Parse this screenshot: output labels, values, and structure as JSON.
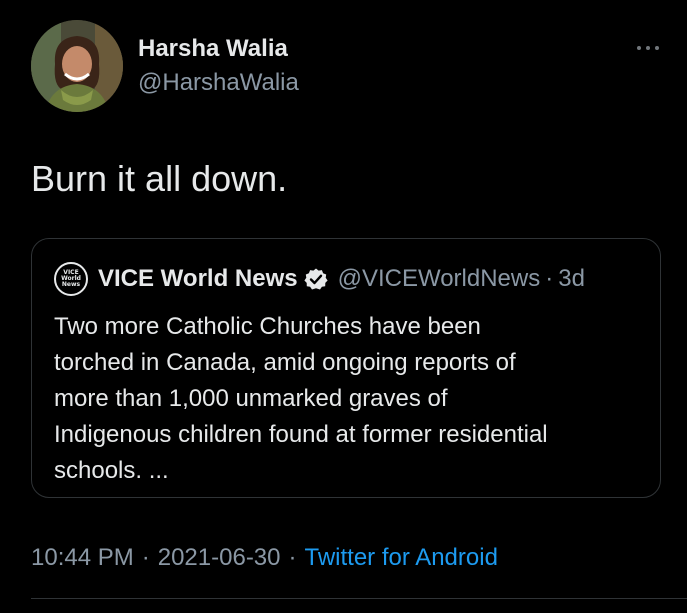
{
  "author": {
    "display_name": "Harsha Walia",
    "handle": "@HarshaWalia",
    "avatar_icon": "profile-photo"
  },
  "tweet": {
    "text": "Burn it all down."
  },
  "quote": {
    "account_logo_lines": [
      "VICE",
      "World",
      "News"
    ],
    "name": "VICE World News",
    "verified_icon": "verified-badge-icon",
    "handle": "@VICEWorldNews",
    "separator": "·",
    "time": "3d",
    "body_lines": [
      "Two more Catholic Churches have been",
      "torched in Canada, amid ongoing reports of",
      "more than 1,000 unmarked graves of",
      "Indigenous children found at former residential",
      "schools. ..."
    ]
  },
  "meta": {
    "time": "10:44 PM",
    "separator": "·",
    "date": "2021-06-30",
    "source": "Twitter for Android"
  },
  "colors": {
    "background": "#000000",
    "text": "#e7e9ea",
    "secondary_text": "#8b98a5",
    "link": "#1d9bf0",
    "border": "#2f3336"
  }
}
